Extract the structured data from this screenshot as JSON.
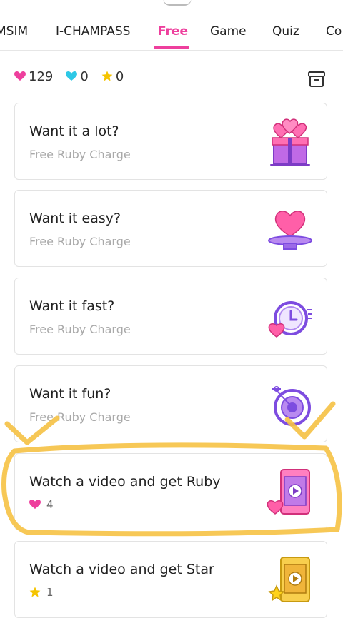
{
  "tabs": [
    {
      "label": "MSIM",
      "active": false
    },
    {
      "label": "I-CHAMPASS",
      "active": false
    },
    {
      "label": "Free",
      "active": true
    },
    {
      "label": "Game",
      "active": false
    },
    {
      "label": "Quiz",
      "active": false
    },
    {
      "label": "Co",
      "active": false
    }
  ],
  "stats": {
    "ruby": "129",
    "diamond": "0",
    "star": "0"
  },
  "cards": [
    {
      "title": "Want it a lot?",
      "subtitle": "Free Ruby Charge",
      "icon": "gift-hearts-icon"
    },
    {
      "title": "Want it easy?",
      "subtitle": "Free Ruby Charge",
      "icon": "heart-plate-icon"
    },
    {
      "title": "Want it fast?",
      "subtitle": "Free Ruby Charge",
      "icon": "clock-heart-icon"
    },
    {
      "title": "Want it fun?",
      "subtitle": "Free Ruby Charge",
      "icon": "target-icon"
    },
    {
      "title": "Watch a video and get Ruby",
      "reward": "4",
      "reward_icon": "heart-icon",
      "icon": "phone-video-heart-icon"
    },
    {
      "title": "Watch a video and get Star",
      "reward": "1",
      "reward_icon": "star-icon",
      "icon": "phone-video-star-icon"
    }
  ],
  "colors": {
    "accent": "#ee3f9d",
    "ruby": "#ee3f9d",
    "diamond": "#2ec8e6",
    "star": "#f5c400",
    "purple": "#7d4ce0",
    "highlighter": "#f6c244"
  }
}
